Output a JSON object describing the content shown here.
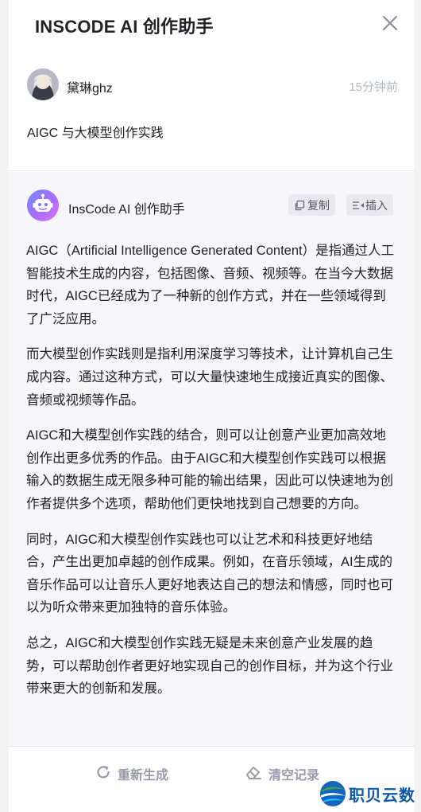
{
  "header": {
    "title": "INSCODE AI 创作助手"
  },
  "user_message": {
    "user_name": "黛琳ghz",
    "time": "15分钟前",
    "question": "AIGC 与大模型创作实践"
  },
  "ai_message": {
    "bot_name": "InsCode AI 创作助手",
    "copy_label": "复制",
    "insert_label": "插入",
    "paragraphs": [
      "AIGC（Artificial Intelligence Generated Content）是指通过人工智能技术生成的内容，包括图像、音频、视频等。在当今大数据时代，AIGC已经成为了一种新的创作方式，并在一些领域得到了广泛应用。",
      "而大模型创作实践则是指利用深度学习等技术，让计算机自己生成内容。通过这种方式，可以大量快速地生成接近真实的图像、音频或视频等作品。",
      "AIGC和大模型创作实践的结合，则可以让创意产业更加高效地创作出更多优秀的作品。由于AIGC和大模型创作实践可以根据输入的数据生成无限多种可能的输出结果，因此可以快速地为创作者提供多个选项，帮助他们更快地找到自己想要的方向。",
      "同时，AIGC和大模型创作实践也可以让艺术和科技更好地结合，产生出更加卓越的创作成果。例如，在音乐领域，AI生成的音乐作品可以让音乐人更好地表达自己的想法和情感，同时也可以为听众带来更加独特的音乐体验。",
      "总之，AIGC和大模型创作实践无疑是未来创意产业发展的趋势，可以帮助创作者更好地实现自己的创作目标，并为这个行业带来更大的创新和发展。"
    ]
  },
  "footer": {
    "regenerate_label": "重新生成",
    "clear_label": "清空记录"
  },
  "watermark": {
    "text": "职贝云数"
  },
  "icons": {
    "close": "close-icon",
    "copy": "copy-icon",
    "insert": "insert-icon",
    "regenerate": "refresh-icon",
    "clear": "eraser-icon",
    "bot": "robot-icon"
  },
  "colors": {
    "muted_text": "#b3b7c2",
    "ai_background": "#f7f7f9",
    "button_background": "#e9e9ee",
    "footer_text": "#999aaa",
    "watermark": "#0f5aa8"
  }
}
